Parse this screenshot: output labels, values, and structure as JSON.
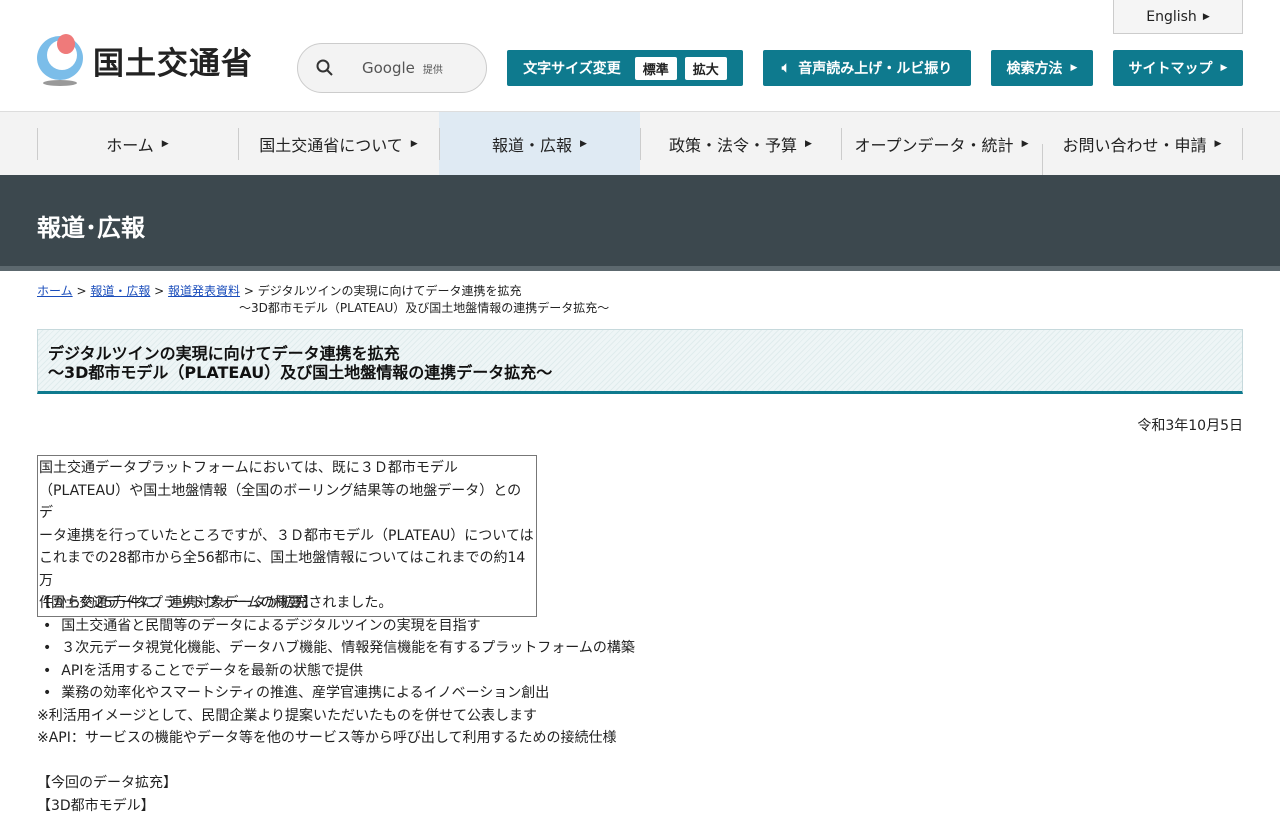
{
  "header": {
    "logo_text": "国土交通省",
    "english": "English",
    "search_brand": "Google",
    "search_provided": "提供",
    "font_size_label": "文字サイズ変更",
    "font_standard": "標準",
    "font_large": "拡大",
    "read_aloud": "音声読み上げ・ルビ振り",
    "search_method": "検索方法",
    "sitemap": "サイトマップ"
  },
  "nav": [
    "ホーム",
    "国土交通省について",
    "報道・広報",
    "政策・法令・予算",
    "オープンデータ・統計",
    "お問い合わせ・申請"
  ],
  "banner_title": "報道･広報",
  "breadcrumb": {
    "home": "ホーム",
    "press": "報道・広報",
    "releases": "報道発表資料",
    "current_line1": "デジタルツインの実現に向けてデータ連携を拡充",
    "current_line2": "～3D都市モデル（PLATEAU）及び国土地盤情報の連携データ拡充～"
  },
  "article": {
    "title_line1": "デジタルツインの実現に向けてデータ連携を拡充",
    "title_line2": "～3D都市モデル（PLATEAU）及び国土地盤情報の連携データ拡充～",
    "date": "令和3年10月5日",
    "summary": [
      "国土交通データプラットフォームにおいては、既に３Ｄ都市モデル",
      "（PLATEAU）や国土地盤情報（全国のボーリング結果等の地盤データ）とのデ",
      "ータ連携を行っていたところですが、３Ｄ都市モデル（PLATEAU）については",
      "これまでの28都市から全56都市に、国土地盤情報についてはこれまでの約14万",
      "件から約25万件に、連携対象データが拡充されました。"
    ],
    "overview_heading": "【国土交通データプラットフォームの概要】",
    "overview_items": [
      "国土交通省と民間等のデータによるデジタルツインの実現を目指す",
      "３次元データ視覚化機能、データハブ機能、情報発信機能を有するプラットフォームの構築",
      "APIを活用することでデータを最新の状態で提供",
      "業務の効率化やスマートシティの推進、産学官連携によるイノベーション創出"
    ],
    "notes": [
      "※利活用イメージとして、民間企業より提案いただいたものを併せて公表します",
      "※API：サービスの機能やデータ等を他のサービス等から呼び出して利用するための接続仕様"
    ],
    "expansion_heading": "【今回のデータ拡充】",
    "expansion_sub": "【3D都市モデル】"
  },
  "colors": {
    "accent": "#0e7a8e",
    "banner": "#3c484e"
  }
}
